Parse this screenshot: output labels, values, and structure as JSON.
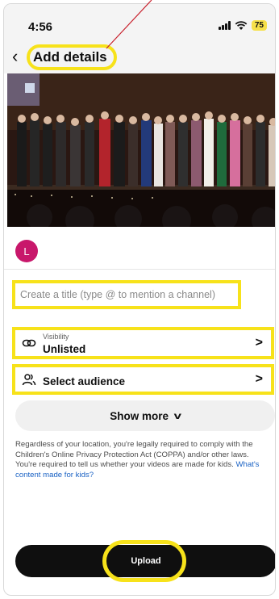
{
  "status_bar": {
    "time": "4:56",
    "battery": "75"
  },
  "header": {
    "title": "Add details"
  },
  "channel": {
    "avatar_letter": "L",
    "avatar_color": "#c8176b"
  },
  "form": {
    "title_placeholder": "Create a title (type @ to mention a channel)",
    "visibility_label": "Visibility",
    "visibility_value": "Unlisted",
    "audience_label": "Select audience",
    "show_more_label": "Show more"
  },
  "legal": {
    "text": "Regardless of your location, you're legally required to comply with the Children's Online Privacy Protection Act (COPPA) and/or other laws. You're required to tell us whether your videos are made for kids.",
    "link_text": "What's content made for kids?"
  },
  "upload": {
    "label": "Upload"
  },
  "colors": {
    "highlight": "#f7e21a",
    "annotation_line": "#c81e2a",
    "link": "#1a62c4"
  },
  "icons": [
    "back-arrow-icon",
    "signal-icon",
    "wifi-icon",
    "battery-icon",
    "link-icon",
    "people-icon",
    "chevron-right-icon",
    "chevron-down-icon"
  ]
}
